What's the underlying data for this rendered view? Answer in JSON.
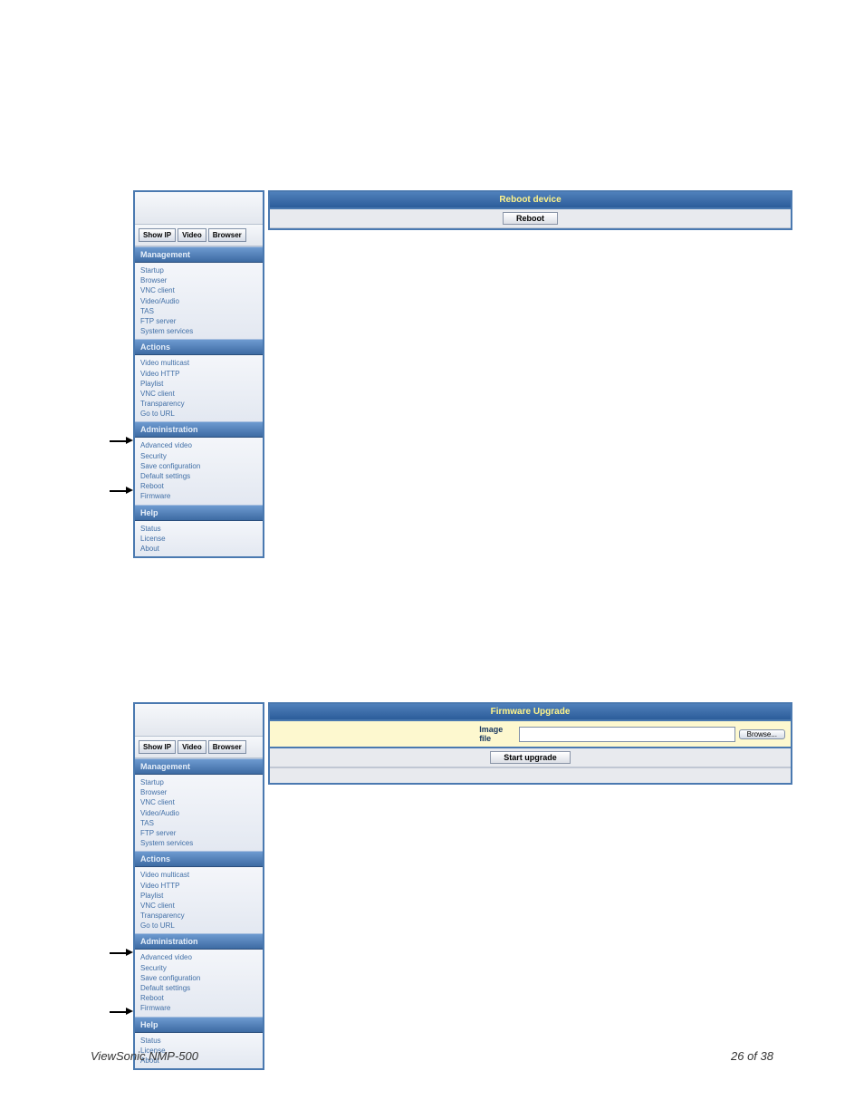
{
  "footer": {
    "left": "ViewSonic NMP-500",
    "right": "26 of  38"
  },
  "buttons": {
    "show_ip": "Show IP",
    "video": "Video",
    "browser": "Browser",
    "reboot": "Reboot",
    "start_upgrade": "Start upgrade",
    "browse": "Browse..."
  },
  "titles": {
    "reboot": "Reboot device",
    "firmware": "Firmware Upgrade"
  },
  "labels": {
    "image_file": "Image file"
  },
  "nav": {
    "management": {
      "head": "Management",
      "items": [
        "Startup",
        "Browser",
        "VNC client",
        "Video/Audio",
        "TAS",
        "FTP server",
        "System services"
      ]
    },
    "actions": {
      "head": "Actions",
      "items": [
        "Video multicast",
        "Video HTTP",
        "Playlist",
        "VNC client",
        "Transparency",
        "Go to URL"
      ]
    },
    "administration": {
      "head": "Administration",
      "items": [
        "Advanced video",
        "Security",
        "Save configuration",
        "Default settings",
        "Reboot",
        "Firmware"
      ]
    },
    "help": {
      "head": "Help",
      "items": [
        "Status",
        "License",
        "About"
      ]
    }
  }
}
